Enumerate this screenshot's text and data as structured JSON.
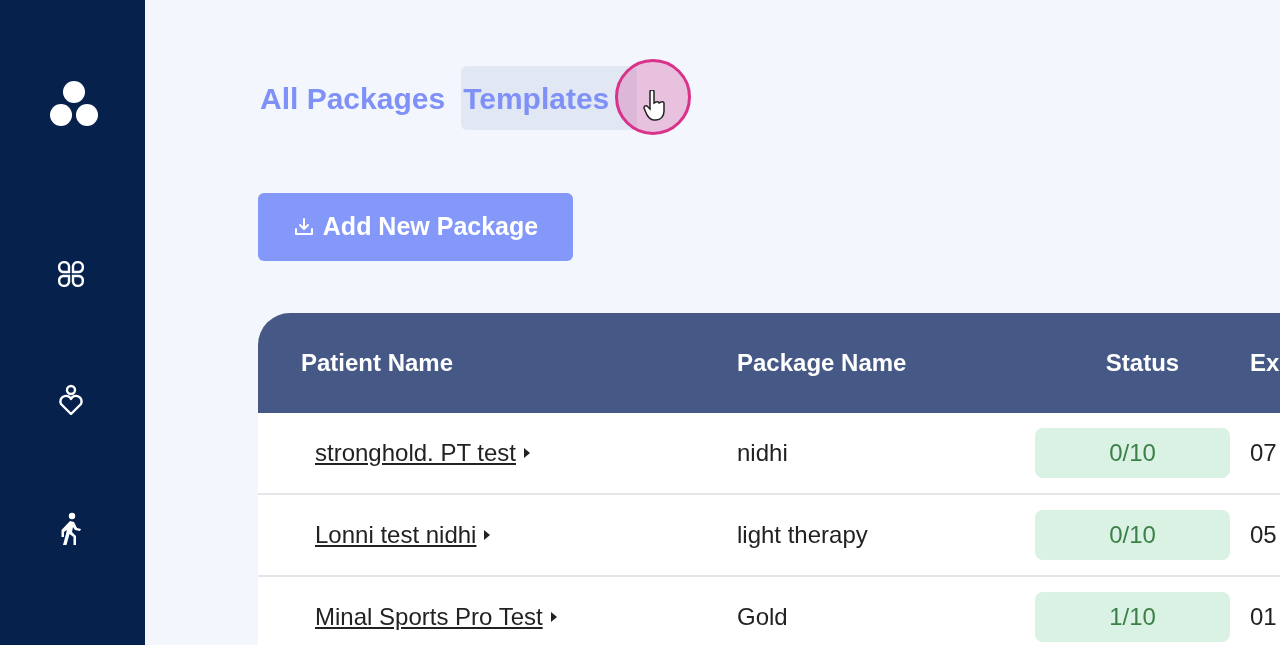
{
  "tabs": [
    {
      "label": "All Packages",
      "selected": false
    },
    {
      "label": "Templates",
      "selected": true
    }
  ],
  "add_button": {
    "label": "Add New Package"
  },
  "table": {
    "columns": [
      "Patient Name",
      "Package Name",
      "Status",
      "Ex"
    ],
    "rows": [
      {
        "patient": "stronghold. PT test",
        "package": "nidhi",
        "status": "0/10",
        "column_4": "07"
      },
      {
        "patient": "Lonni test nidhi",
        "package": "light therapy",
        "status": "0/10",
        "column_4": "05"
      },
      {
        "patient": "Minal Sports Pro Test",
        "package": "Gold",
        "status": "1/10",
        "column_4": "01"
      }
    ]
  }
}
